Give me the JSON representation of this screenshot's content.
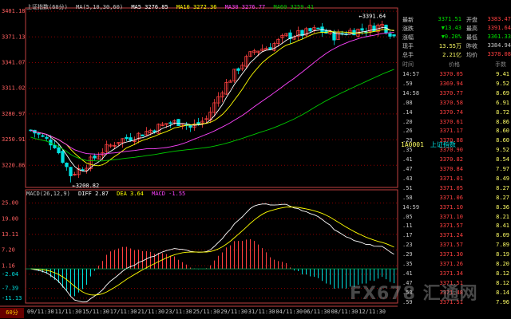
{
  "chart_header": {
    "name": "上证指数(60分)",
    "ma_label": "MA(5,10,30,60)",
    "ma5": "MA5 3276.85",
    "ma10": "MA10 3272.36",
    "ma30": "MA30 3276.77",
    "ma60": "MA60 3259.41"
  },
  "macd_header": {
    "params": "MACD(26,12,9)",
    "diff": "DIFF 2.87",
    "dea": "DEA 3.64",
    "macd": "MACD -1.55"
  },
  "price_axis": [
    "3401.18",
    "3371.13",
    "3341.07",
    "3311.02",
    "3280.97",
    "3250.91",
    "3220.86"
  ],
  "macd_axis": [
    "25.00",
    "19.00",
    "13.11",
    "7.20",
    "1.16",
    "-2.04",
    "-7.39",
    "-11.13"
  ],
  "annotations": {
    "high": "3391.64",
    "low": "3200.82"
  },
  "x_labels": [
    "09/11:30",
    "11/11:30",
    "15/11:30",
    "17/11:30",
    "21/11:30",
    "23/11:30",
    "25/11:30",
    "29/11:30",
    "31/11:30",
    "04/11:30",
    "06/11:30",
    "08/11:30",
    "12/11:30"
  ],
  "period_tab": "60分",
  "quote": {
    "rows": [
      {
        "l": "最新",
        "v": "3371.51",
        "l2": "开盘",
        "v2": "3383.47"
      },
      {
        "l": "涨跌",
        "v": "▼13.43",
        "l2": "最高",
        "v2": "3391.64"
      },
      {
        "l": "涨幅",
        "v": "▼0.20%",
        "l2": "最低",
        "v2": "3361.33"
      },
      {
        "l": "现手",
        "v": "13.55万",
        "l2": "昨收",
        "v2": "3384.94"
      },
      {
        "l": "总手",
        "v": "2.21亿",
        "l2": "均价",
        "v2": "3378.08"
      }
    ],
    "colors": {
      "v": [
        "#00e000",
        "#00e000",
        "#00e000",
        "#ffff66",
        "#ffff66"
      ],
      "v2": [
        "#ff4040",
        "#ff4040",
        "#00e000",
        "#c8c8c8",
        "#ff4040"
      ]
    }
  },
  "index_code": "1A0001",
  "index_name": "上证指数",
  "tick_header": {
    "time": "时间",
    "price": "价格",
    "qty": "手数"
  },
  "ticks": [
    {
      "t": "14:57",
      "p": "3370.05",
      "q": "9.41"
    },
    {
      "t": ".59",
      "p": "3369.94",
      "q": "9.52"
    },
    {
      "t": "14:58",
      "p": "3370.77",
      "q": "8.69"
    },
    {
      "t": ".08",
      "p": "3370.58",
      "q": "6.91"
    },
    {
      "t": ".14",
      "p": "3370.74",
      "q": "8.72"
    },
    {
      "t": ".20",
      "p": "3370.61",
      "q": "8.86"
    },
    {
      "t": ".26",
      "p": "3371.17",
      "q": "8.60"
    },
    {
      "t": ".29",
      "p": "3370.88",
      "q": "8.60"
    },
    {
      "t": ".35",
      "p": "3370.90",
      "q": "9.52"
    },
    {
      "t": ".41",
      "p": "3370.82",
      "q": "8.54"
    },
    {
      "t": ".47",
      "p": "3370.84",
      "q": "7.97"
    },
    {
      "t": ".43",
      "p": "3371.01",
      "q": "8.49"
    },
    {
      "t": ".51",
      "p": "3371.05",
      "q": "8.27"
    },
    {
      "t": ".58",
      "p": "3371.06",
      "q": "8.27"
    },
    {
      "t": "14:59",
      "p": "3371.10",
      "q": "8.36"
    },
    {
      "t": ".05",
      "p": "3371.10",
      "q": "8.21"
    },
    {
      "t": ".11",
      "p": "3371.57",
      "q": "8.41"
    },
    {
      "t": ".17",
      "p": "3371.24",
      "q": "8.09"
    },
    {
      "t": ".23",
      "p": "3371.57",
      "q": "7.89"
    },
    {
      "t": ".29",
      "p": "3371.30",
      "q": "8.19"
    },
    {
      "t": ".35",
      "p": "3371.26",
      "q": "8.20"
    },
    {
      "t": ".41",
      "p": "3371.34",
      "q": "8.12"
    },
    {
      "t": ".47",
      "p": "3371.51",
      "q": "8.12"
    },
    {
      "t": ".53",
      "p": "3371.48",
      "q": "8.14"
    },
    {
      "t": ".59",
      "p": "3371.51",
      "q": "7.96"
    }
  ],
  "watermark": "FX678 汇通网",
  "colors": {
    "up": "#ff4040",
    "down": "#00e0e0",
    "ma5": "#ffffff",
    "ma10": "#ffff00",
    "ma30": "#ff44ff",
    "ma60": "#00cc00",
    "grid": "#8b0000",
    "axis": "#c04040"
  }
}
